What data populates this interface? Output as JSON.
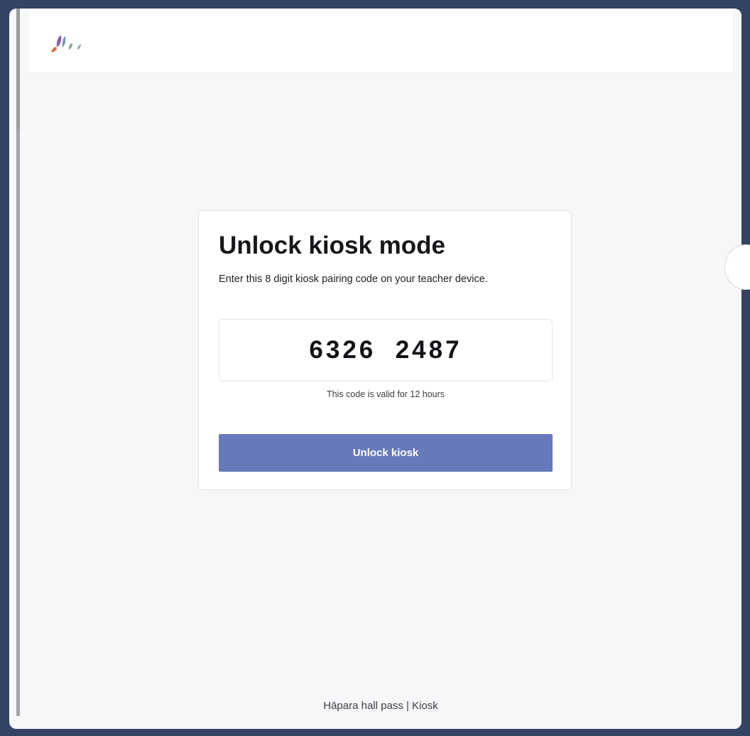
{
  "app": {
    "logo_icon": "hapara-logo-icon",
    "brand_colors": [
      "#e3703a",
      "#8b5fa8",
      "#6f9fb0",
      "#7fa89a"
    ]
  },
  "card": {
    "title": "Unlock kiosk mode",
    "description": "Enter this 8 digit kiosk pairing code on your teacher device.",
    "code": "6326  2487",
    "validity_note": "This code is valid for 12 hours",
    "button_label": "Unlock kiosk",
    "button_color": "#6679bb"
  },
  "footer": {
    "text": "Hāpara hall pass | Kiosk"
  }
}
